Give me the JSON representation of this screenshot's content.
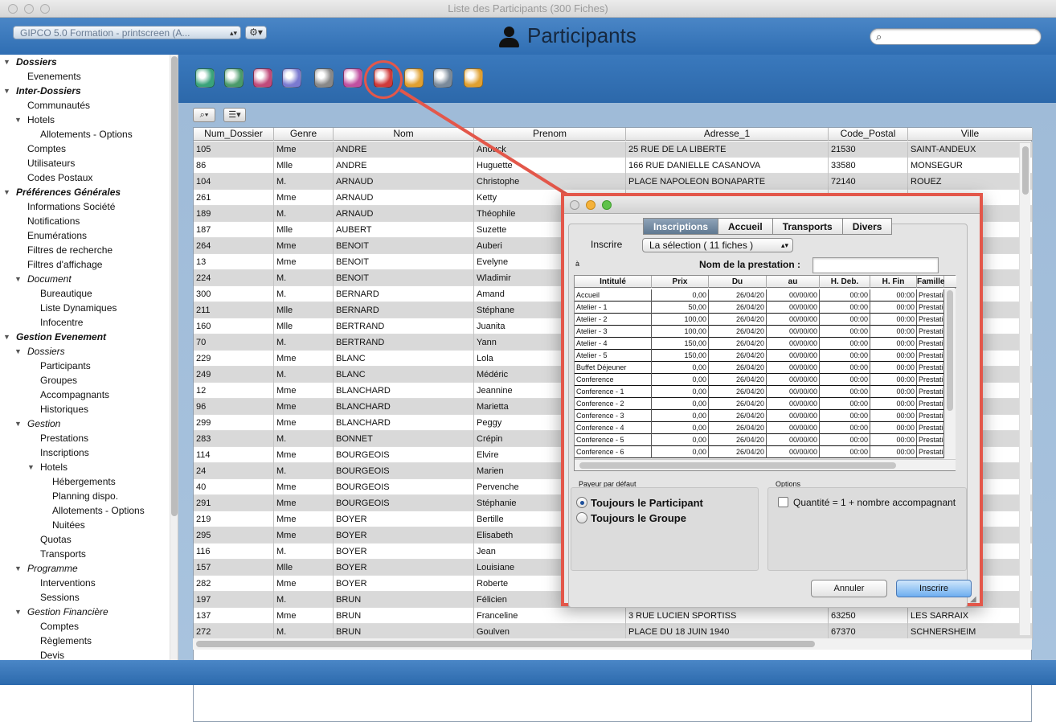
{
  "window": {
    "title": "Liste des Participants (300 Fiches)"
  },
  "header": {
    "file_selector": "GIPCO 5.0 Formation - printscreen (A...",
    "gear_label": "⚙▾",
    "page_title": "Participants",
    "search_placeholder": ""
  },
  "sidebar": {
    "items": [
      {
        "label": "Dossiers",
        "style": "hdr",
        "tri": true,
        "indent": 0
      },
      {
        "label": "Evenements",
        "style": "",
        "tri": false,
        "indent": 1
      },
      {
        "label": "Inter-Dossiers",
        "style": "hdr",
        "tri": true,
        "indent": 0
      },
      {
        "label": "Communautés",
        "style": "",
        "tri": false,
        "indent": 1
      },
      {
        "label": "Hotels",
        "style": "",
        "tri": true,
        "indent": 1
      },
      {
        "label": "Allotements - Options",
        "style": "",
        "tri": false,
        "indent": 2
      },
      {
        "label": "Comptes",
        "style": "",
        "tri": false,
        "indent": 1
      },
      {
        "label": "Utilisateurs",
        "style": "",
        "tri": false,
        "indent": 1
      },
      {
        "label": "Codes Postaux",
        "style": "",
        "tri": false,
        "indent": 1
      },
      {
        "label": "Préférences Générales",
        "style": "hdr",
        "tri": true,
        "indent": 0
      },
      {
        "label": "Informations Société",
        "style": "",
        "tri": false,
        "indent": 1
      },
      {
        "label": "Notifications",
        "style": "",
        "tri": false,
        "indent": 1
      },
      {
        "label": "Enumérations",
        "style": "",
        "tri": false,
        "indent": 1
      },
      {
        "label": "Filtres de recherche",
        "style": "",
        "tri": false,
        "indent": 1
      },
      {
        "label": "Filtres d'affichage",
        "style": "",
        "tri": false,
        "indent": 1
      },
      {
        "label": "Document",
        "style": "sub",
        "tri": true,
        "indent": 1
      },
      {
        "label": "Bureautique",
        "style": "",
        "tri": false,
        "indent": 2
      },
      {
        "label": "Liste Dynamiques",
        "style": "",
        "tri": false,
        "indent": 2
      },
      {
        "label": "Infocentre",
        "style": "",
        "tri": false,
        "indent": 2
      },
      {
        "label": "Gestion Evenement",
        "style": "hdr",
        "tri": true,
        "indent": 0
      },
      {
        "label": "Dossiers",
        "style": "sub",
        "tri": true,
        "indent": 1
      },
      {
        "label": "Participants",
        "style": "",
        "tri": false,
        "indent": 2
      },
      {
        "label": "Groupes",
        "style": "",
        "tri": false,
        "indent": 2
      },
      {
        "label": "Accompagnants",
        "style": "",
        "tri": false,
        "indent": 2
      },
      {
        "label": "Historiques",
        "style": "",
        "tri": false,
        "indent": 2
      },
      {
        "label": "Gestion",
        "style": "sub",
        "tri": true,
        "indent": 1
      },
      {
        "label": "Prestations",
        "style": "",
        "tri": false,
        "indent": 2
      },
      {
        "label": "Inscriptions",
        "style": "",
        "tri": false,
        "indent": 2
      },
      {
        "label": "Hotels",
        "style": "",
        "tri": true,
        "indent": 2
      },
      {
        "label": "Hébergements",
        "style": "",
        "tri": false,
        "indent": 3
      },
      {
        "label": "Planning dispo.",
        "style": "",
        "tri": false,
        "indent": 3
      },
      {
        "label": "Allotements - Options",
        "style": "",
        "tri": false,
        "indent": 3
      },
      {
        "label": "Nuitées",
        "style": "",
        "tri": false,
        "indent": 3
      },
      {
        "label": "Quotas",
        "style": "",
        "tri": false,
        "indent": 2
      },
      {
        "label": "Transports",
        "style": "",
        "tri": false,
        "indent": 2
      },
      {
        "label": "Programme",
        "style": "sub",
        "tri": true,
        "indent": 1
      },
      {
        "label": "Interventions",
        "style": "",
        "tri": false,
        "indent": 2
      },
      {
        "label": "Sessions",
        "style": "",
        "tri": false,
        "indent": 2
      },
      {
        "label": "Gestion Financière",
        "style": "sub",
        "tri": true,
        "indent": 1
      },
      {
        "label": "Comptes",
        "style": "",
        "tri": false,
        "indent": 2
      },
      {
        "label": "Règlements",
        "style": "",
        "tri": false,
        "indent": 2
      },
      {
        "label": "Devis",
        "style": "",
        "tri": false,
        "indent": 2
      }
    ]
  },
  "toolbar": {
    "icons": [
      {
        "name": "new-record-icon",
        "color": "#3aa37a"
      },
      {
        "name": "edit-record-icon",
        "color": "#4a9a6a"
      },
      {
        "name": "globe-icon",
        "color": "#c04a7a"
      },
      {
        "name": "find-icon",
        "color": "#7a7ad0"
      },
      {
        "name": "print-preview-icon",
        "color": "#888888"
      },
      {
        "name": "export-icon",
        "color": "#c050a0"
      },
      {
        "name": "toolbox-icon",
        "color": "#d03a3a"
      },
      {
        "name": "mail-icon",
        "color": "#e0a030"
      },
      {
        "name": "print-icon",
        "color": "#7a8a9a"
      },
      {
        "name": "spreadsheet-icon",
        "color": "#e0a030"
      }
    ],
    "search_menu": "⌕▾",
    "list_menu": "☰▾"
  },
  "table": {
    "columns": [
      "Num_Dossier",
      "Genre",
      "Nom",
      "Prenom",
      "Adresse_1",
      "Code_Postal",
      "Ville"
    ],
    "rows": [
      [
        "105",
        "Mme",
        "ANDRE",
        "Anouck",
        "25 RUE DE LA LIBERTE",
        "21530",
        "SAINT-ANDEUX"
      ],
      [
        "86",
        "Mlle",
        "ANDRE",
        "Huguette",
        "166 RUE DANIELLE CASANOVA",
        "33580",
        "MONSEGUR"
      ],
      [
        "104",
        "M.",
        "ARNAUD",
        "Christophe",
        "PLACE NAPOLEON BONAPARTE",
        "72140",
        "ROUEZ"
      ],
      [
        "261",
        "Mme",
        "ARNAUD",
        "Ketty",
        "",
        "",
        "UR-LOIRE"
      ],
      [
        "189",
        "M.",
        "ARNAUD",
        "Théophile",
        "",
        "",
        ""
      ],
      [
        "187",
        "Mlle",
        "AUBERT",
        "Suzette",
        "",
        "",
        ""
      ],
      [
        "264",
        "Mme",
        "BENOIT",
        "Auberi",
        "",
        "",
        ""
      ],
      [
        "13",
        "Mme",
        "BENOIT",
        "Evelyne",
        "",
        "",
        ""
      ],
      [
        "224",
        "M.",
        "BENOIT",
        "Wladimir",
        "",
        "",
        "DIREAU"
      ],
      [
        "300",
        "M.",
        "BERNARD",
        "Amand",
        "",
        "",
        ""
      ],
      [
        "211",
        "Mlle",
        "BERNARD",
        "Stéphane",
        "",
        "",
        "EFONTAINE"
      ],
      [
        "160",
        "Mlle",
        "BERTRAND",
        "Juanita",
        "",
        "",
        ""
      ],
      [
        "70",
        "M.",
        "BERTRAND",
        "Yann",
        "",
        "",
        ""
      ],
      [
        "229",
        "Mme",
        "BLANC",
        "Lola",
        "",
        "",
        ""
      ],
      [
        "249",
        "M.",
        "BLANC",
        "Médéric",
        "",
        "",
        "THEON"
      ],
      [
        "12",
        "Mme",
        "BLANCHARD",
        "Jeannine",
        "",
        "",
        "SAULX"
      ],
      [
        "96",
        "Mme",
        "BLANCHARD",
        "Marietta",
        "",
        "",
        ""
      ],
      [
        "299",
        "Mme",
        "BLANCHARD",
        "Peggy",
        "",
        "",
        ""
      ],
      [
        "283",
        "M.",
        "BONNET",
        "Crépin",
        "",
        "",
        "E"
      ],
      [
        "114",
        "Mme",
        "BOURGEOIS",
        "Elvire",
        "",
        "",
        "PTOIS"
      ],
      [
        "24",
        "M.",
        "BOURGEOIS",
        "Marien",
        "",
        "",
        ""
      ],
      [
        "40",
        "Mme",
        "BOURGEOIS",
        "Pervenche",
        "",
        "",
        ""
      ],
      [
        "291",
        "Mme",
        "BOURGEOIS",
        "Stéphanie",
        "",
        "",
        ""
      ],
      [
        "219",
        "Mme",
        "BOYER",
        "Bertille",
        "",
        "",
        "-L'ESCAUT"
      ],
      [
        "295",
        "Mme",
        "BOYER",
        "Elisabeth",
        "",
        "",
        ""
      ],
      [
        "116",
        "M.",
        "BOYER",
        "Jean",
        "",
        "",
        "UES"
      ],
      [
        "157",
        "Mlle",
        "BOYER",
        "Louisiane",
        "",
        "",
        "ARVE"
      ],
      [
        "282",
        "Mme",
        "BOYER",
        "Roberte",
        "",
        "",
        "GE"
      ],
      [
        "197",
        "M.",
        "BRUN",
        "Félicien",
        "",
        "",
        ""
      ],
      [
        "137",
        "Mme",
        "BRUN",
        "Franceline",
        "3 RUE LUCIEN SPORTISS",
        "63250",
        "LES SARRAIX"
      ],
      [
        "272",
        "M.",
        "BRUN",
        "Goulven",
        "PLACE DU 18 JUIN 1940",
        "67370",
        "SCHNERSHEIM"
      ]
    ]
  },
  "dialog": {
    "tabs": [
      "Inscriptions",
      "Accueil",
      "Transports",
      "Divers"
    ],
    "active_tab": 0,
    "inscrire_label": "Inscrire",
    "selection_value": "La sélection ( 11 fiches )",
    "a_label": "à",
    "nom_prestation_label": "Nom de la prestation :",
    "nom_prestation_value": "",
    "columns": [
      "Intitulé",
      "Prix",
      "Du",
      "au",
      "H. Deb.",
      "H. Fin",
      "Famille"
    ],
    "rows": [
      [
        "Accueil",
        "0,00",
        "26/04/20",
        "00/00/00",
        "00:00",
        "00:00",
        "Prestation Libre"
      ],
      [
        "Atelier - 1",
        "50,00",
        "26/04/20",
        "00/00/00",
        "00:00",
        "00:00",
        "Prestation Libre"
      ],
      [
        "Atelier - 2",
        "100,00",
        "26/04/20",
        "00/00/00",
        "00:00",
        "00:00",
        "Prestation Libre"
      ],
      [
        "Atelier - 3",
        "100,00",
        "26/04/20",
        "00/00/00",
        "00:00",
        "00:00",
        "Prestation Libre"
      ],
      [
        "Atelier - 4",
        "150,00",
        "26/04/20",
        "00/00/00",
        "00:00",
        "00:00",
        "Prestation Libre"
      ],
      [
        "Atelier - 5",
        "150,00",
        "26/04/20",
        "00/00/00",
        "00:00",
        "00:00",
        "Prestation Libre"
      ],
      [
        "Buffet Déjeuner",
        "0,00",
        "26/04/20",
        "00/00/00",
        "00:00",
        "00:00",
        "Prestation Libre"
      ],
      [
        "Conference",
        "0,00",
        "26/04/20",
        "00/00/00",
        "00:00",
        "00:00",
        "Prestation Libre"
      ],
      [
        "Conference - 1",
        "0,00",
        "26/04/20",
        "00/00/00",
        "00:00",
        "00:00",
        "Prestation Libre"
      ],
      [
        "Conference - 2",
        "0,00",
        "26/04/20",
        "00/00/00",
        "00:00",
        "00:00",
        "Prestation Libre"
      ],
      [
        "Conference - 3",
        "0,00",
        "26/04/20",
        "00/00/00",
        "00:00",
        "00:00",
        "Prestation Libre"
      ],
      [
        "Conference - 4",
        "0,00",
        "26/04/20",
        "00/00/00",
        "00:00",
        "00:00",
        "Prestation Libre"
      ],
      [
        "Conference - 5",
        "0,00",
        "26/04/20",
        "00/00/00",
        "00:00",
        "00:00",
        "Prestation Libre"
      ],
      [
        "Conference - 6",
        "0,00",
        "26/04/20",
        "00/00/00",
        "00:00",
        "00:00",
        "Prestation Libre"
      ]
    ],
    "payeur_label": "Payeur par défaut",
    "payeur_options": [
      "Toujours le Participant",
      "Toujours le Groupe"
    ],
    "payeur_selected": 0,
    "options_label": "Options",
    "quantity_option": "Quantité = 1 + nombre accompagnant",
    "quantity_checked": false,
    "cancel_label": "Annuler",
    "submit_label": "Inscrire"
  },
  "colors": {
    "accent": "#e3574a",
    "header_blue": "#3a79bd"
  }
}
